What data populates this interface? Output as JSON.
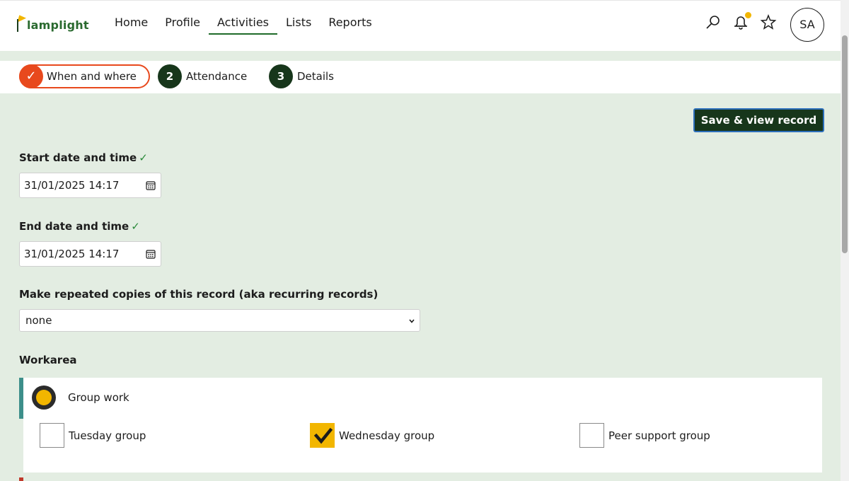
{
  "brand": {
    "name": "lamplight"
  },
  "nav": {
    "items": [
      {
        "label": "Home",
        "active": false
      },
      {
        "label": "Profile",
        "active": false
      },
      {
        "label": "Activities",
        "active": true
      },
      {
        "label": "Lists",
        "active": false
      },
      {
        "label": "Reports",
        "active": false
      }
    ]
  },
  "header": {
    "icons": [
      "search-icon",
      "bell-icon",
      "star-icon"
    ],
    "user_initials": "SA"
  },
  "steps": [
    {
      "marker": "✓",
      "label": "When and where",
      "state": "current"
    },
    {
      "marker": "2",
      "label": "Attendance",
      "state": "pending"
    },
    {
      "marker": "3",
      "label": "Details",
      "state": "pending"
    }
  ],
  "actions": {
    "save_label": "Save & view record"
  },
  "form": {
    "start": {
      "label": "Start date and time",
      "tick": "✓",
      "value": "31/01/2025 14:17"
    },
    "end": {
      "label": "End date and time",
      "tick": "✓",
      "value": "31/01/2025 14:17"
    },
    "recurring": {
      "label": "Make repeated copies of this record (aka recurring records)",
      "value": "none"
    },
    "workarea": {
      "label": "Workarea",
      "group": {
        "label": "Group work",
        "selected": true
      },
      "options": [
        {
          "label": "Tuesday group",
          "checked": false
        },
        {
          "label": "Wednesday group",
          "checked": true
        },
        {
          "label": "Peer support group",
          "checked": false
        }
      ]
    }
  },
  "colors": {
    "accent": "#e8491d",
    "dark_green": "#17361b",
    "light_green_bg": "#e3ede2",
    "yellow": "#f2b600",
    "teal": "#3d8f8a"
  }
}
